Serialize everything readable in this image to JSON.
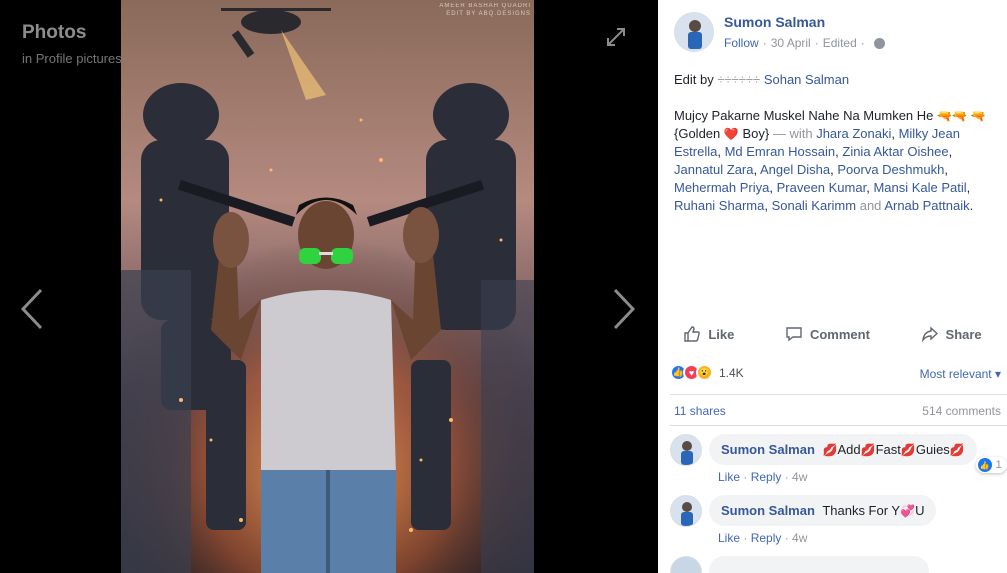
{
  "viewer": {
    "title": "Photos",
    "subtitle_prefix": "in",
    "album": "Profile pictures",
    "watermark_line1": "AMEER BASHAH QUADRI",
    "watermark_line2": "EDIT BY ABQ.DESIGNS"
  },
  "post": {
    "author": "Sumon Salman",
    "follow_label": "Follow",
    "date": "30 April",
    "edited_label": "Edited",
    "edit_by_prefix": "Edit by",
    "edit_by_symbols": "÷÷÷÷÷÷",
    "edit_by_name": "Sohan Salman",
    "caption_line": "Mujcy Pakarne Muskel Nahe Na Mumken He",
    "caption_golden": "{Golden",
    "caption_boy": "Boy}",
    "with_label": "— with",
    "tagged": [
      "Jhara Zonaki",
      "Milky Jean Estrella",
      "Md Emran Hossain",
      "Zinia Aktar Oishee",
      "Jannatul Zara",
      "Angel Disha",
      "Poorva Deshmukh",
      "Mehermah Priya",
      "Praveen Kumar",
      "Mansi Kale Patil",
      "Ruhani Sharma",
      "Sonali Karimm"
    ],
    "and_label": "and",
    "last_tagged": "Arnab Pattnaik"
  },
  "actions": {
    "like": "Like",
    "comment": "Comment",
    "share": "Share"
  },
  "stats": {
    "reactions_count": "1.4K",
    "sort_label": "Most relevant",
    "shares": "11 shares",
    "comments": "514 comments"
  },
  "comments": [
    {
      "name": "Sumon Salman",
      "text_parts": [
        "Add",
        "Fast",
        "Guies"
      ],
      "like": "Like",
      "reply": "Reply",
      "time": "4w",
      "reaction_count": "1"
    },
    {
      "name": "Sumon Salman",
      "text_a": "Thanks For Y",
      "text_b": "U",
      "like": "Like",
      "reply": "Reply",
      "time": "4w"
    }
  ],
  "colors": {
    "link": "#365899",
    "action_link": "#4267b2",
    "muted": "#90949c",
    "like_blue": "#1877f2",
    "love_red": "#f33e58",
    "wow_yellow": "#f7b125"
  }
}
